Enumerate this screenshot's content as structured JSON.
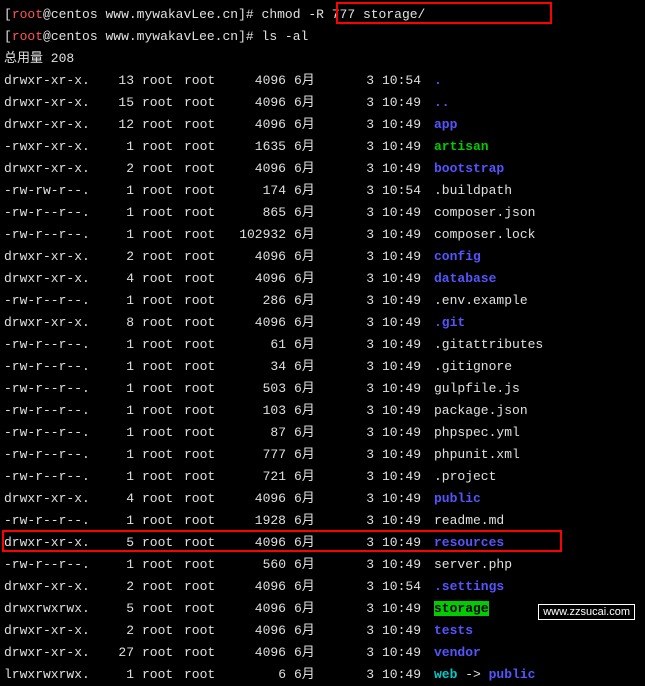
{
  "prompt": {
    "user": "root",
    "host": "centos",
    "path": "www.mywakavLee.cn",
    "symbol": "#"
  },
  "commands": {
    "cmd1": "chmod -R 777 storage/",
    "cmd2": "ls -al"
  },
  "total_label": "总用量 208",
  "listing": [
    {
      "perm": "drwxr-xr-x.",
      "links": "13",
      "owner": "root",
      "group": "root",
      "size": "4096",
      "month": "6月",
      "day": "3",
      "time": "10:54",
      "name": ".",
      "cls": "dir-blue"
    },
    {
      "perm": "drwxr-xr-x.",
      "links": "15",
      "owner": "root",
      "group": "root",
      "size": "4096",
      "month": "6月",
      "day": "3",
      "time": "10:49",
      "name": "..",
      "cls": "dir-blue"
    },
    {
      "perm": "drwxr-xr-x.",
      "links": "12",
      "owner": "root",
      "group": "root",
      "size": "4096",
      "month": "6月",
      "day": "3",
      "time": "10:49",
      "name": "app",
      "cls": "dir-blue"
    },
    {
      "perm": "-rwxr-xr-x.",
      "links": "1",
      "owner": "root",
      "group": "root",
      "size": "1635",
      "month": "6月",
      "day": "3",
      "time": "10:49",
      "name": "artisan",
      "cls": "exec-green"
    },
    {
      "perm": "drwxr-xr-x.",
      "links": "2",
      "owner": "root",
      "group": "root",
      "size": "4096",
      "month": "6月",
      "day": "3",
      "time": "10:49",
      "name": "bootstrap",
      "cls": "dir-blue"
    },
    {
      "perm": "-rw-rw-r--.",
      "links": "1",
      "owner": "root",
      "group": "root",
      "size": "174",
      "month": "6月",
      "day": "3",
      "time": "10:54",
      "name": ".buildpath",
      "cls": "fname"
    },
    {
      "perm": "-rw-r--r--.",
      "links": "1",
      "owner": "root",
      "group": "root",
      "size": "865",
      "month": "6月",
      "day": "3",
      "time": "10:49",
      "name": "composer.json",
      "cls": "fname"
    },
    {
      "perm": "-rw-r--r--.",
      "links": "1",
      "owner": "root",
      "group": "root",
      "size": "102932",
      "month": "6月",
      "day": "3",
      "time": "10:49",
      "name": "composer.lock",
      "cls": "fname"
    },
    {
      "perm": "drwxr-xr-x.",
      "links": "2",
      "owner": "root",
      "group": "root",
      "size": "4096",
      "month": "6月",
      "day": "3",
      "time": "10:49",
      "name": "config",
      "cls": "dir-blue"
    },
    {
      "perm": "drwxr-xr-x.",
      "links": "4",
      "owner": "root",
      "group": "root",
      "size": "4096",
      "month": "6月",
      "day": "3",
      "time": "10:49",
      "name": "database",
      "cls": "dir-blue"
    },
    {
      "perm": "-rw-r--r--.",
      "links": "1",
      "owner": "root",
      "group": "root",
      "size": "286",
      "month": "6月",
      "day": "3",
      "time": "10:49",
      "name": ".env.example",
      "cls": "fname"
    },
    {
      "perm": "drwxr-xr-x.",
      "links": "8",
      "owner": "root",
      "group": "root",
      "size": "4096",
      "month": "6月",
      "day": "3",
      "time": "10:49",
      "name": ".git",
      "cls": "dir-blue"
    },
    {
      "perm": "-rw-r--r--.",
      "links": "1",
      "owner": "root",
      "group": "root",
      "size": "61",
      "month": "6月",
      "day": "3",
      "time": "10:49",
      "name": ".gitattributes",
      "cls": "fname"
    },
    {
      "perm": "-rw-r--r--.",
      "links": "1",
      "owner": "root",
      "group": "root",
      "size": "34",
      "month": "6月",
      "day": "3",
      "time": "10:49",
      "name": ".gitignore",
      "cls": "fname"
    },
    {
      "perm": "-rw-r--r--.",
      "links": "1",
      "owner": "root",
      "group": "root",
      "size": "503",
      "month": "6月",
      "day": "3",
      "time": "10:49",
      "name": "gulpfile.js",
      "cls": "fname"
    },
    {
      "perm": "-rw-r--r--.",
      "links": "1",
      "owner": "root",
      "group": "root",
      "size": "103",
      "month": "6月",
      "day": "3",
      "time": "10:49",
      "name": "package.json",
      "cls": "fname"
    },
    {
      "perm": "-rw-r--r--.",
      "links": "1",
      "owner": "root",
      "group": "root",
      "size": "87",
      "month": "6月",
      "day": "3",
      "time": "10:49",
      "name": "phpspec.yml",
      "cls": "fname"
    },
    {
      "perm": "-rw-r--r--.",
      "links": "1",
      "owner": "root",
      "group": "root",
      "size": "777",
      "month": "6月",
      "day": "3",
      "time": "10:49",
      "name": "phpunit.xml",
      "cls": "fname"
    },
    {
      "perm": "-rw-r--r--.",
      "links": "1",
      "owner": "root",
      "group": "root",
      "size": "721",
      "month": "6月",
      "day": "3",
      "time": "10:49",
      "name": ".project",
      "cls": "fname"
    },
    {
      "perm": "drwxr-xr-x.",
      "links": "4",
      "owner": "root",
      "group": "root",
      "size": "4096",
      "month": "6月",
      "day": "3",
      "time": "10:49",
      "name": "public",
      "cls": "dir-blue"
    },
    {
      "perm": "-rw-r--r--.",
      "links": "1",
      "owner": "root",
      "group": "root",
      "size": "1928",
      "month": "6月",
      "day": "3",
      "time": "10:49",
      "name": "readme.md",
      "cls": "fname"
    },
    {
      "perm": "drwxr-xr-x.",
      "links": "5",
      "owner": "root",
      "group": "root",
      "size": "4096",
      "month": "6月",
      "day": "3",
      "time": "10:49",
      "name": "resources",
      "cls": "dir-blue"
    },
    {
      "perm": "-rw-r--r--.",
      "links": "1",
      "owner": "root",
      "group": "root",
      "size": "560",
      "month": "6月",
      "day": "3",
      "time": "10:49",
      "name": "server.php",
      "cls": "fname"
    },
    {
      "perm": "drwxr-xr-x.",
      "links": "2",
      "owner": "root",
      "group": "root",
      "size": "4096",
      "month": "6月",
      "day": "3",
      "time": "10:54",
      "name": ".settings",
      "cls": "dir-blue"
    },
    {
      "perm": "drwxrwxrwx.",
      "links": "5",
      "owner": "root",
      "group": "root",
      "size": "4096",
      "month": "6月",
      "day": "3",
      "time": "10:49",
      "name": "storage",
      "cls": "highlight-green"
    },
    {
      "perm": "drwxr-xr-x.",
      "links": "2",
      "owner": "root",
      "group": "root",
      "size": "4096",
      "month": "6月",
      "day": "3",
      "time": "10:49",
      "name": "tests",
      "cls": "dir-blue"
    },
    {
      "perm": "drwxr-xr-x.",
      "links": "27",
      "owner": "root",
      "group": "root",
      "size": "4096",
      "month": "6月",
      "day": "3",
      "time": "10:49",
      "name": "vendor",
      "cls": "dir-blue"
    },
    {
      "perm": "lrwxrwxrwx.",
      "links": "1",
      "owner": "root",
      "group": "root",
      "size": "6",
      "month": "6月",
      "day": "3",
      "time": "10:49",
      "name": "web",
      "cls": "link-cyan",
      "arrow": " -> ",
      "target": "public",
      "target_cls": "dir-blue"
    }
  ],
  "watermark": "www.zzsucai.com"
}
